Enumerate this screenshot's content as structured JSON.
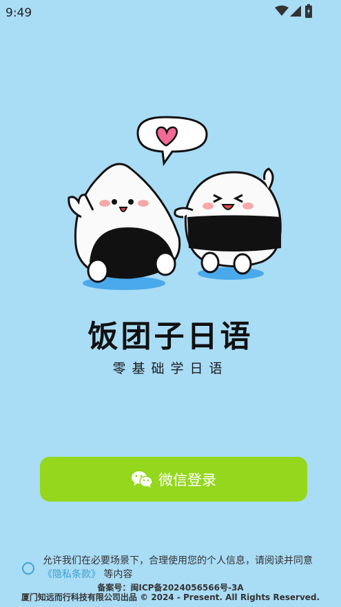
{
  "status_bar": {
    "time": "9:49",
    "icons": [
      "wifi-icon",
      "signal-icon",
      "battery-icon"
    ]
  },
  "app": {
    "title": "饭团子日语",
    "subtitle": "零基础学日语"
  },
  "login": {
    "wechat_label": "微信登录",
    "button_color": "#94d71d"
  },
  "agreement": {
    "text_before": "允许我们在必要场景下，合理使用您的个人信息，请阅读并同意",
    "link_text": "《隐私条款》",
    "text_after": "等内容",
    "link_color": "#3aa0ce"
  },
  "footer": {
    "icp": "备案号：闽ICP备2024056566号-3A",
    "copyright": "厦门知远而行科技有限公司出品 © 2024 - Present. All Rights Reserved."
  },
  "colors": {
    "background": "#a9dcf5",
    "accent": "#94d71d"
  }
}
